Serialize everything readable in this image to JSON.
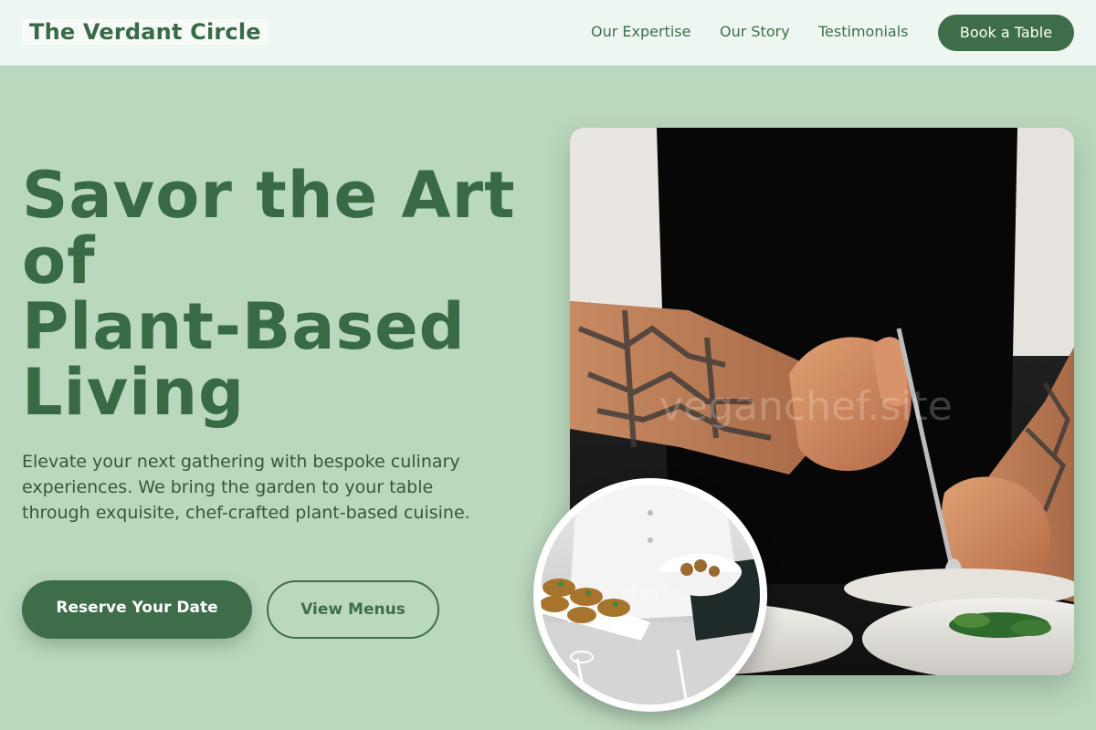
{
  "header": {
    "brand": "The Verdant Circle",
    "nav": [
      "Our Expertise",
      "Our Story",
      "Testimonials"
    ],
    "cta": "Book a Table"
  },
  "hero": {
    "title_lines": [
      "Savor the Art",
      "of",
      "Plant-Based",
      "Living"
    ],
    "subtitle": "Elevate your next gathering with bespoke culinary experiences. We bring the garden to your table through exquisite, chef-crafted plant-based cuisine.",
    "primary_button": "Reserve Your Date",
    "secondary_button": "View Menus"
  },
  "images": {
    "main_watermark": "veganchef.site",
    "inset_watermark": "chef"
  },
  "colors": {
    "background": "#bad8bd",
    "header_bg": "#eef6f1",
    "brand_green": "#386b45",
    "button_green": "#3e6e49"
  }
}
